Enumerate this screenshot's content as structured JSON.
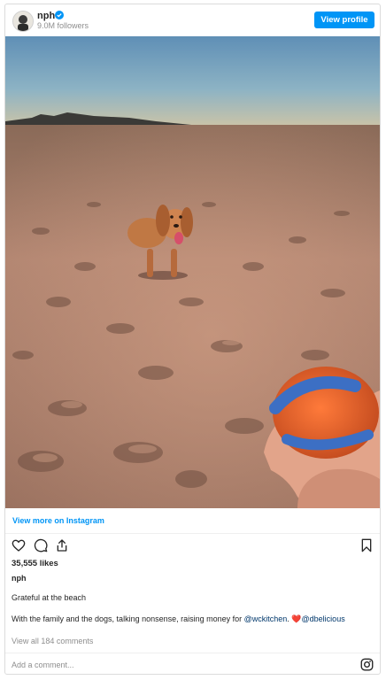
{
  "header": {
    "username": "nph",
    "followers": "9.0M followers",
    "view_profile_label": "View profile"
  },
  "photo": {
    "alt": "Dog running on the beach at sunset toward an orange and blue ball"
  },
  "view_more_label": "View more on Instagram",
  "actions": {
    "like_icon": "heart-icon",
    "comment_icon": "comment-icon",
    "share_icon": "share-icon",
    "save_icon": "bookmark-icon"
  },
  "likes": "35,555 likes",
  "caption": {
    "owner": "nph",
    "line1": "Grateful at the beach",
    "line2_text": "With the family and the dogs, talking nonsense, raising money for ",
    "mention1": "@wckitchen",
    "line2_mid": ". ",
    "heart": "❤️",
    "mention2": "@dbelicious"
  },
  "view_comments": "View all 184 comments",
  "comment_input": {
    "placeholder": "Add a comment..."
  },
  "colors": {
    "accent": "#0095f6",
    "mention": "#00376b",
    "muted": "#8e8e8e"
  }
}
